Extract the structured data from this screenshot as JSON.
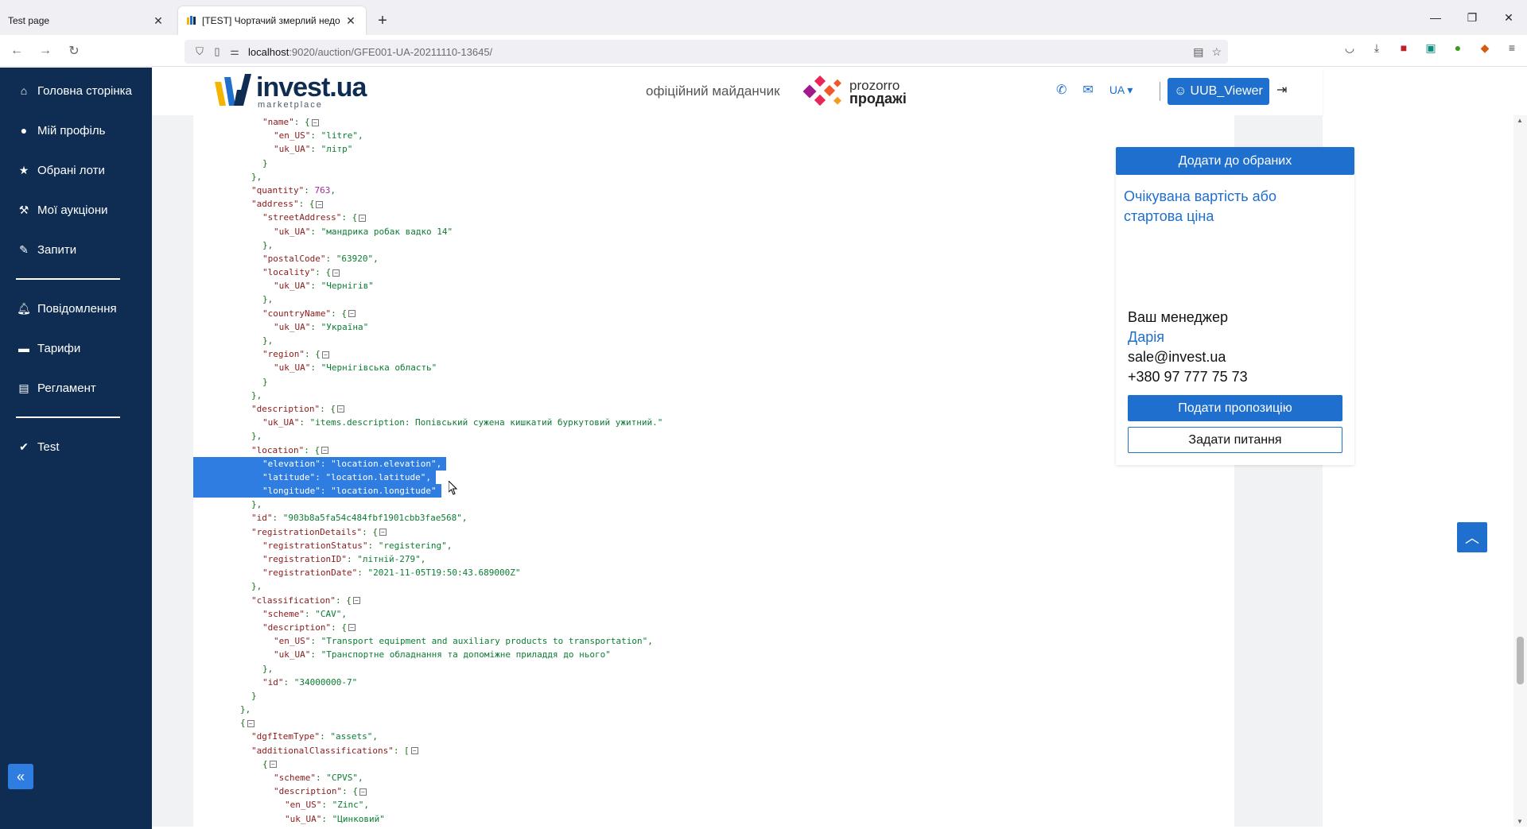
{
  "browser": {
    "tabs": [
      {
        "title": "Test page",
        "active": false
      },
      {
        "title": "[TEST] Чортачий змерлий недо",
        "active": true
      }
    ],
    "url_host": "localhost",
    "url_path": ":9020/auction/GFE001-UA-20211110-13645/"
  },
  "sidebar": {
    "items": [
      {
        "label": "Головна сторінка",
        "icon": "home-icon"
      },
      {
        "label": "Мій профіль",
        "icon": "user-icon"
      },
      {
        "label": "Обрані лоти",
        "icon": "star-icon"
      },
      {
        "label": "Мої аукціони",
        "icon": "gavel-icon"
      },
      {
        "label": "Запити",
        "icon": "pencil-icon"
      },
      {
        "label": "Повідомлення",
        "icon": "bell-icon"
      },
      {
        "label": "Тарифи",
        "icon": "money-icon"
      },
      {
        "label": "Регламент",
        "icon": "document-icon"
      },
      {
        "label": "Test",
        "icon": "check-circle-icon"
      }
    ]
  },
  "header": {
    "logo_main": "invest.ua",
    "logo_sub": "marketplace",
    "official": "офіційний майданчик",
    "prozorro_1": "prozorro",
    "prozorro_2": "продажі",
    "lang": "UA",
    "user": "UUB_Viewer"
  },
  "card": {
    "fav_button": "Додати до обраних",
    "price_title": "Очікувана вартість або стартова ціна",
    "manager_label": "Ваш менеджер",
    "manager_name": "Дарія",
    "manager_email": "sale@invest.ua",
    "manager_phone": "+380 97 777 75 73",
    "offer_button": "Подати пропозицію",
    "ask_button": "Задати питання"
  },
  "json_lines": [
    {
      "i": 6,
      "t": [
        [
          "k",
          "\"name\""
        ],
        [
          "p",
          ": {"
        ],
        [
          "tog",
          ""
        ]
      ]
    },
    {
      "i": 7,
      "t": [
        [
          "k",
          "\"en_US\""
        ],
        [
          "p",
          ": "
        ],
        [
          "s",
          "\"litre\""
        ],
        [
          "p",
          ","
        ]
      ]
    },
    {
      "i": 7,
      "t": [
        [
          "k",
          "\"uk_UA\""
        ],
        [
          "p",
          ": "
        ],
        [
          "s",
          "\"літр\""
        ]
      ]
    },
    {
      "i": 6,
      "t": [
        [
          "p",
          "}"
        ]
      ]
    },
    {
      "i": 5,
      "t": [
        [
          "p",
          "},"
        ]
      ]
    },
    {
      "i": 5,
      "t": [
        [
          "k",
          "\"quantity\""
        ],
        [
          "p",
          ": "
        ],
        [
          "n",
          "763"
        ],
        [
          "p",
          ","
        ]
      ]
    },
    {
      "i": 5,
      "t": [
        [
          "k",
          "\"address\""
        ],
        [
          "p",
          ": {"
        ],
        [
          "tog",
          ""
        ]
      ]
    },
    {
      "i": 6,
      "t": [
        [
          "k",
          "\"streetAddress\""
        ],
        [
          "p",
          ": {"
        ],
        [
          "tog",
          ""
        ]
      ]
    },
    {
      "i": 7,
      "t": [
        [
          "k",
          "\"uk_UA\""
        ],
        [
          "p",
          ": "
        ],
        [
          "s",
          "\"мандрика робак вадко 14\""
        ]
      ]
    },
    {
      "i": 6,
      "t": [
        [
          "p",
          "},"
        ]
      ]
    },
    {
      "i": 6,
      "t": [
        [
          "k",
          "\"postalCode\""
        ],
        [
          "p",
          ": "
        ],
        [
          "s",
          "\"63920\""
        ],
        [
          "p",
          ","
        ]
      ]
    },
    {
      "i": 6,
      "t": [
        [
          "k",
          "\"locality\""
        ],
        [
          "p",
          ": {"
        ],
        [
          "tog",
          ""
        ]
      ]
    },
    {
      "i": 7,
      "t": [
        [
          "k",
          "\"uk_UA\""
        ],
        [
          "p",
          ": "
        ],
        [
          "s",
          "\"Чернігів\""
        ]
      ]
    },
    {
      "i": 6,
      "t": [
        [
          "p",
          "},"
        ]
      ]
    },
    {
      "i": 6,
      "t": [
        [
          "k",
          "\"countryName\""
        ],
        [
          "p",
          ": {"
        ],
        [
          "tog",
          ""
        ]
      ]
    },
    {
      "i": 7,
      "t": [
        [
          "k",
          "\"uk_UA\""
        ],
        [
          "p",
          ": "
        ],
        [
          "s",
          "\"Україна\""
        ]
      ]
    },
    {
      "i": 6,
      "t": [
        [
          "p",
          "},"
        ]
      ]
    },
    {
      "i": 6,
      "t": [
        [
          "k",
          "\"region\""
        ],
        [
          "p",
          ": {"
        ],
        [
          "tog",
          ""
        ]
      ]
    },
    {
      "i": 7,
      "t": [
        [
          "k",
          "\"uk_UA\""
        ],
        [
          "p",
          ": "
        ],
        [
          "s",
          "\"Чернігівська область\""
        ]
      ]
    },
    {
      "i": 6,
      "t": [
        [
          "p",
          "}"
        ]
      ]
    },
    {
      "i": 5,
      "t": [
        [
          "p",
          "},"
        ]
      ]
    },
    {
      "i": 5,
      "t": [
        [
          "k",
          "\"description\""
        ],
        [
          "p",
          ": {"
        ],
        [
          "tog",
          ""
        ]
      ]
    },
    {
      "i": 6,
      "t": [
        [
          "k",
          "\"uk_UA\""
        ],
        [
          "p",
          ": "
        ],
        [
          "s",
          "\"items.description: Попівський сужена кишкатий буркутовий ужитний.\""
        ]
      ]
    },
    {
      "i": 5,
      "t": [
        [
          "p",
          "},"
        ]
      ]
    },
    {
      "i": 5,
      "t": [
        [
          "k",
          "\"location\""
        ],
        [
          "p",
          ": {"
        ],
        [
          "tog",
          ""
        ]
      ]
    },
    {
      "i": 6,
      "sel": true,
      "t": [
        [
          "k",
          "\"elevation\""
        ],
        [
          "p",
          ": "
        ],
        [
          "s",
          "\"location.elevation\""
        ],
        [
          "p",
          ","
        ]
      ]
    },
    {
      "i": 6,
      "sel": true,
      "t": [
        [
          "k",
          "\"latitude\""
        ],
        [
          "p",
          ": "
        ],
        [
          "s",
          "\"location.latitude\""
        ],
        [
          "p",
          ","
        ]
      ]
    },
    {
      "i": 6,
      "sel": true,
      "t": [
        [
          "k",
          "\"longitude\""
        ],
        [
          "p",
          ": "
        ],
        [
          "s",
          "\"location.longitude\""
        ]
      ]
    },
    {
      "i": 5,
      "t": [
        [
          "p",
          "},"
        ]
      ]
    },
    {
      "i": 5,
      "t": [
        [
          "k",
          "\"id\""
        ],
        [
          "p",
          ": "
        ],
        [
          "s",
          "\"903b8a5fa54c484fbf1901cbb3fae568\""
        ],
        [
          "p",
          ","
        ]
      ]
    },
    {
      "i": 5,
      "t": [
        [
          "k",
          "\"registrationDetails\""
        ],
        [
          "p",
          ": {"
        ],
        [
          "tog",
          ""
        ]
      ]
    },
    {
      "i": 6,
      "t": [
        [
          "k",
          "\"registrationStatus\""
        ],
        [
          "p",
          ": "
        ],
        [
          "s",
          "\"registering\""
        ],
        [
          "p",
          ","
        ]
      ]
    },
    {
      "i": 6,
      "t": [
        [
          "k",
          "\"registrationID\""
        ],
        [
          "p",
          ": "
        ],
        [
          "s",
          "\"літній-279\""
        ],
        [
          "p",
          ","
        ]
      ]
    },
    {
      "i": 6,
      "t": [
        [
          "k",
          "\"registrationDate\""
        ],
        [
          "p",
          ": "
        ],
        [
          "s",
          "\"2021-11-05T19:50:43.689000Z\""
        ]
      ]
    },
    {
      "i": 5,
      "t": [
        [
          "p",
          "},"
        ]
      ]
    },
    {
      "i": 5,
      "t": [
        [
          "k",
          "\"classification\""
        ],
        [
          "p",
          ": {"
        ],
        [
          "tog",
          ""
        ]
      ]
    },
    {
      "i": 6,
      "t": [
        [
          "k",
          "\"scheme\""
        ],
        [
          "p",
          ": "
        ],
        [
          "s",
          "\"CAV\""
        ],
        [
          "p",
          ","
        ]
      ]
    },
    {
      "i": 6,
      "t": [
        [
          "k",
          "\"description\""
        ],
        [
          "p",
          ": {"
        ],
        [
          "tog",
          ""
        ]
      ]
    },
    {
      "i": 7,
      "t": [
        [
          "k",
          "\"en_US\""
        ],
        [
          "p",
          ": "
        ],
        [
          "s",
          "\"Transport equipment and auxiliary products to transportation\""
        ],
        [
          "p",
          ","
        ]
      ]
    },
    {
      "i": 7,
      "t": [
        [
          "k",
          "\"uk_UA\""
        ],
        [
          "p",
          ": "
        ],
        [
          "s",
          "\"Транспортне обладнання та допоміжне приладдя до нього\""
        ]
      ]
    },
    {
      "i": 6,
      "t": [
        [
          "p",
          "},"
        ]
      ]
    },
    {
      "i": 6,
      "t": [
        [
          "k",
          "\"id\""
        ],
        [
          "p",
          ": "
        ],
        [
          "s",
          "\"34000000-7\""
        ]
      ]
    },
    {
      "i": 5,
      "t": [
        [
          "p",
          "}"
        ]
      ]
    },
    {
      "i": 4,
      "t": [
        [
          "p",
          "},"
        ]
      ]
    },
    {
      "i": 4,
      "t": [
        [
          "p",
          "{"
        ],
        [
          "tog",
          ""
        ]
      ]
    },
    {
      "i": 5,
      "t": [
        [
          "k",
          "\"dgfItemType\""
        ],
        [
          "p",
          ": "
        ],
        [
          "s",
          "\"assets\""
        ],
        [
          "p",
          ","
        ]
      ]
    },
    {
      "i": 5,
      "t": [
        [
          "k",
          "\"additionalClassifications\""
        ],
        [
          "p",
          ": ["
        ],
        [
          "tog",
          ""
        ]
      ]
    },
    {
      "i": 6,
      "t": [
        [
          "p",
          "{"
        ],
        [
          "tog",
          ""
        ]
      ]
    },
    {
      "i": 7,
      "t": [
        [
          "k",
          "\"scheme\""
        ],
        [
          "p",
          ": "
        ],
        [
          "s",
          "\"CPVS\""
        ],
        [
          "p",
          ","
        ]
      ]
    },
    {
      "i": 7,
      "t": [
        [
          "k",
          "\"description\""
        ],
        [
          "p",
          ": {"
        ],
        [
          "tog",
          ""
        ]
      ]
    },
    {
      "i": 8,
      "t": [
        [
          "k",
          "\"en_US\""
        ],
        [
          "p",
          ": "
        ],
        [
          "s",
          "\"Zinc\""
        ],
        [
          "p",
          ","
        ]
      ]
    },
    {
      "i": 8,
      "t": [
        [
          "k",
          "\"uk_UA\""
        ],
        [
          "p",
          ": "
        ],
        [
          "s",
          "\"Цинковий\""
        ]
      ]
    },
    {
      "i": 7,
      "t": [
        [
          "p",
          "},"
        ]
      ]
    }
  ]
}
